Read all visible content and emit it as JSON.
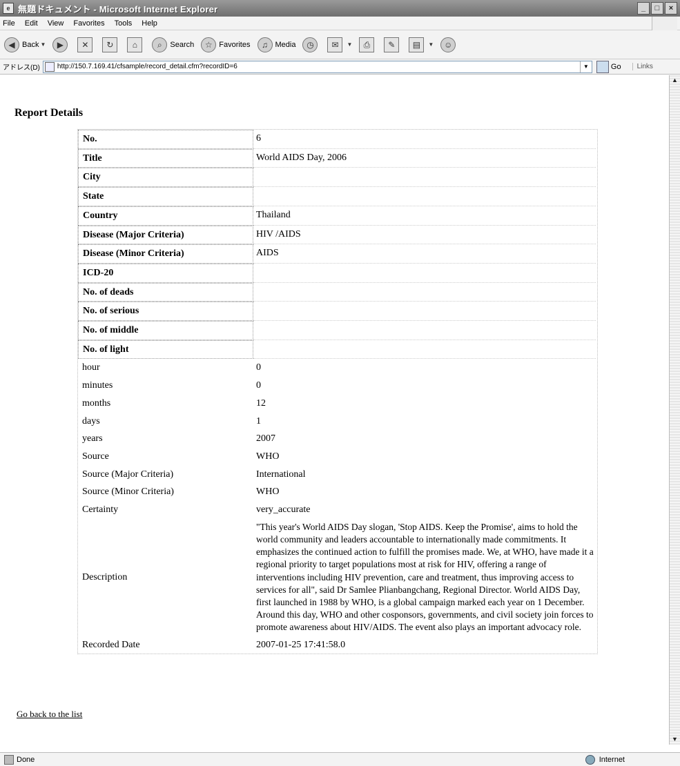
{
  "window": {
    "title": "無題ドキュメント - Microsoft Internet Explorer"
  },
  "menu": [
    "File",
    "Edit",
    "View",
    "Favorites",
    "Tools",
    "Help"
  ],
  "toolbar": {
    "back": "Back",
    "search": "Search",
    "favorites": "Favorites",
    "media": "Media"
  },
  "address": {
    "label": "アドレス(D)",
    "url": "http://150.7.169.41/cfsample/record_detail.cfm?recordID=6",
    "go": "Go",
    "links": "Links"
  },
  "page": {
    "title": "Report Details",
    "back_link": "Go back to the list"
  },
  "rows": [
    {
      "label": "No.",
      "value": "6"
    },
    {
      "label": "Title",
      "value": "World AIDS Day, 2006"
    },
    {
      "label": "City",
      "value": ""
    },
    {
      "label": "State",
      "value": ""
    },
    {
      "label": "Country",
      "value": "Thailand"
    },
    {
      "label": "Disease (Major Criteria)",
      "value": "HIV /AIDS"
    },
    {
      "label": "Disease (Minor Criteria)",
      "value": "AIDS"
    },
    {
      "label": "ICD-20",
      "value": ""
    },
    {
      "label": "No. of deads",
      "value": ""
    },
    {
      "label": "No. of serious",
      "value": ""
    },
    {
      "label": "No. of middle",
      "value": ""
    },
    {
      "label": "No. of light",
      "value": ""
    },
    {
      "label": "hour",
      "value": "0"
    },
    {
      "label": "minutes",
      "value": "0"
    },
    {
      "label": "months",
      "value": "12"
    },
    {
      "label": "days",
      "value": "1"
    },
    {
      "label": "years",
      "value": "2007"
    },
    {
      "label": "Source",
      "value": "WHO"
    },
    {
      "label": "Source (Major Criteria)",
      "value": "International"
    },
    {
      "label": "Source (Minor Criteria)",
      "value": "WHO"
    },
    {
      "label": "Certainty",
      "value": "very_accurate"
    },
    {
      "label": "Description",
      "value": "\"This year's World AIDS Day slogan, 'Stop AIDS. Keep the Promise', aims to hold the world community and leaders accountable to internationally made commitments. It emphasizes the continued action to fulfill the promises made. We, at WHO, have made it a regional priority to target populations most at risk for HIV, offering a range of interventions including HIV prevention, care and treatment, thus improving access to services for all\", said Dr Samlee Plianbangchang, Regional Director. World AIDS Day, first launched in 1988 by WHO, is a global campaign marked each year on 1 December. Around this day, WHO and other cosponsors, governments, and civil society join forces to promote awareness about HIV/AIDS. The event also plays an important advocacy role."
    },
    {
      "label": "Recorded Date",
      "value": "2007-01-25 17:41:58.0"
    }
  ],
  "status": {
    "left": "Done",
    "zone": "Internet"
  }
}
